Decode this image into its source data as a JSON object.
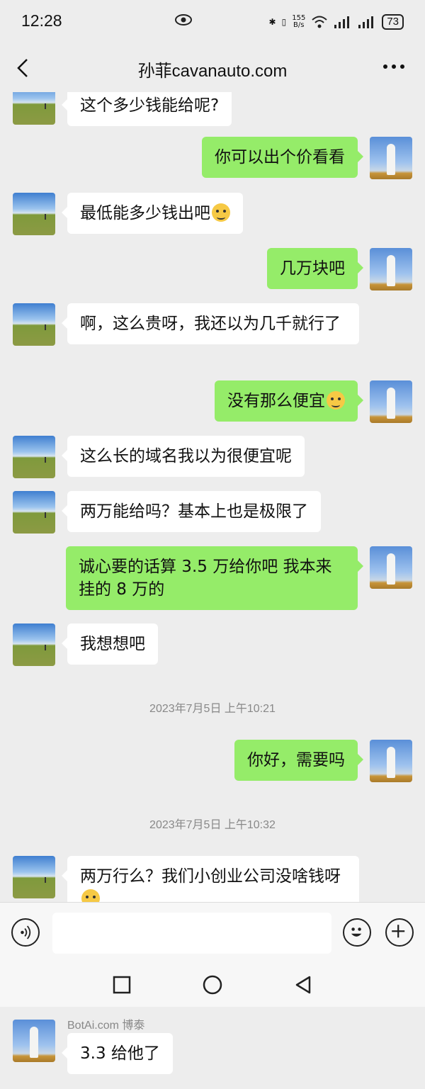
{
  "status_bar": {
    "time": "12:28",
    "net_speed_value": "155",
    "net_speed_unit": "B/s",
    "battery": "73"
  },
  "header": {
    "title": "孙菲cavanauto.com"
  },
  "messages": [
    {
      "side": "in",
      "text": "这个多少钱能给呢?"
    },
    {
      "side": "out",
      "text": "你可以出个价看看"
    },
    {
      "side": "in",
      "text": "最低能多少钱出吧",
      "emoji": "laugh-cry"
    },
    {
      "side": "out",
      "text": "几万块吧"
    },
    {
      "side": "in",
      "text": "啊，这么贵呀，我还以为几千就行了"
    },
    {
      "side": "out",
      "text": "没有那么便宜",
      "emoji": "nervous"
    },
    {
      "side": "in",
      "text": "这么长的域名我以为很便宜呢"
    },
    {
      "side": "in",
      "text": "两万能给吗？基本上也是极限了"
    },
    {
      "side": "out",
      "text": "诚心要的话算 3.5 万给你吧  我本来挂的 8 万的"
    },
    {
      "side": "in",
      "text": "我想想吧"
    },
    {
      "timestamp": "2023年7月5日 上午10:21"
    },
    {
      "side": "out",
      "text": "你好，需要吗"
    },
    {
      "timestamp": "2023年7月5日 上午10:32"
    },
    {
      "side": "in",
      "text": "两万行么？我们小创业公司没啥钱呀",
      "emoji": "laugh-cry"
    }
  ],
  "input": {
    "placeholder": ""
  },
  "quote": {
    "sender": "BotAi.com 博泰",
    "text": "3.3 给他了"
  },
  "icons": {
    "back": "back-arrow-icon",
    "more": "more-dots-icon",
    "voice": "voice-icon",
    "emoji": "emoji-icon",
    "plus": "plus-icon",
    "nav_recent": "square-icon",
    "nav_home": "circle-icon",
    "nav_back": "triangle-back-icon"
  },
  "colors": {
    "outgoing_bubble": "#95ec69",
    "incoming_bubble": "#ffffff",
    "background": "#ededed"
  }
}
